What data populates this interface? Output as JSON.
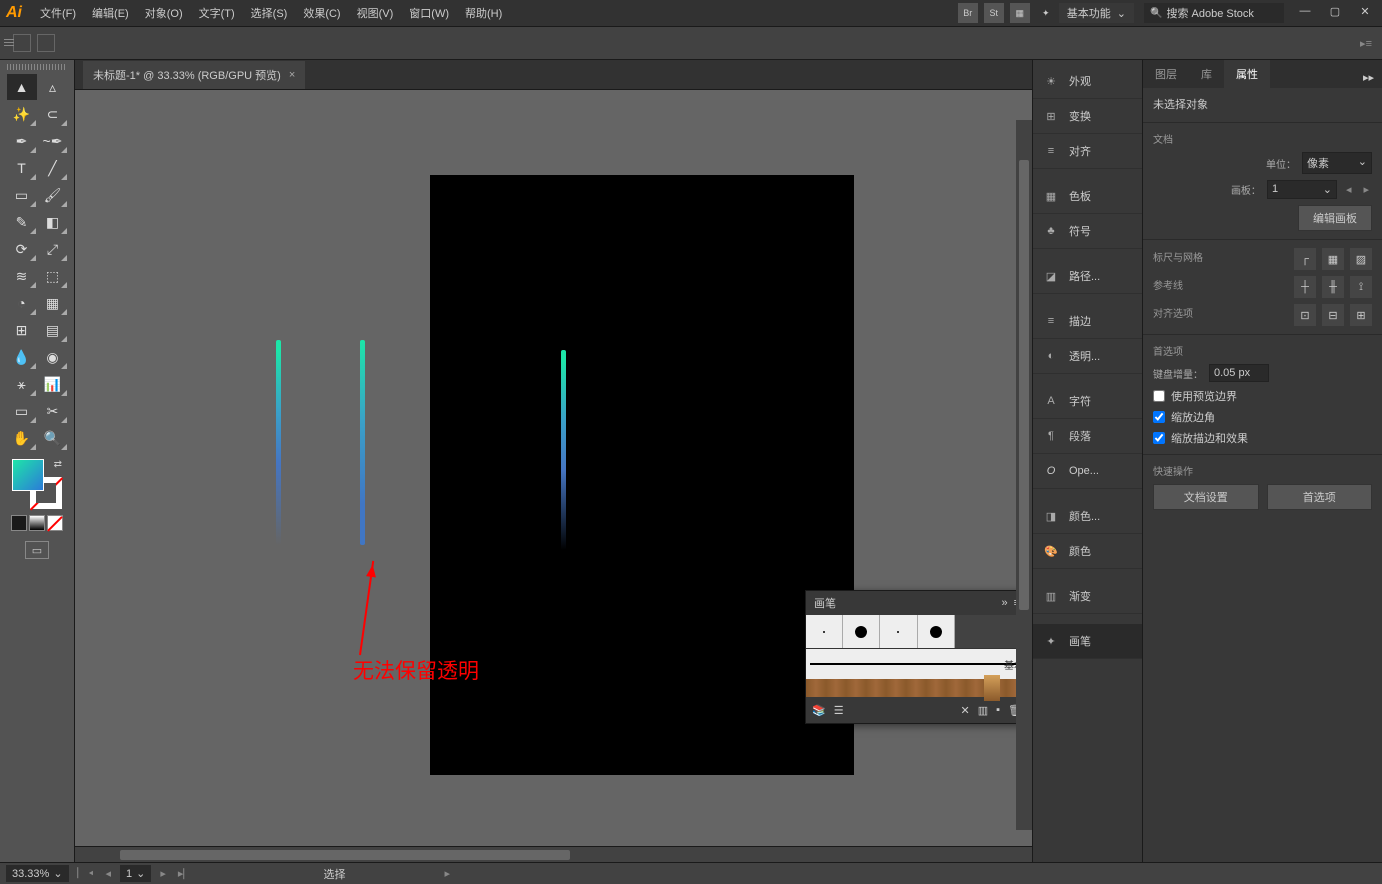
{
  "app": {
    "logo": "Ai"
  },
  "menu": {
    "file": "文件(F)",
    "edit": "编辑(E)",
    "object": "对象(O)",
    "type": "文字(T)",
    "select": "选择(S)",
    "effect": "效果(C)",
    "view": "视图(V)",
    "window": "窗口(W)",
    "help": "帮助(H)"
  },
  "workspace": {
    "label": "基本功能"
  },
  "search": {
    "placeholder": "搜索 Adobe Stock"
  },
  "document": {
    "tab_title": "未标题-1* @ 33.33% (RGB/GPU 预览)",
    "close": "×"
  },
  "annotation": {
    "text": "无法保留透明"
  },
  "brush_panel": {
    "title": "画笔",
    "basic": "基本",
    "expand": "»"
  },
  "dock": {
    "appearance": "外观",
    "transform": "变换",
    "align": "对齐",
    "swatches": "色板",
    "symbols": "符号",
    "pathfinder": "路径...",
    "stroke": "描边",
    "transparency": "透明...",
    "character": "字符",
    "paragraph": "段落",
    "opentype": "Ope...",
    "colorguide": "颜色...",
    "color": "颜色",
    "gradient": "渐变",
    "brushes": "画笔"
  },
  "panel_tabs": {
    "layers": "图层",
    "libraries": "库",
    "properties": "属性"
  },
  "props": {
    "no_sel": "未选择对象",
    "doc_sect": "文档",
    "unit_label": "单位：",
    "unit_value": "像素",
    "artboard_label": "画板：",
    "artboard_value": "1",
    "edit_artboards": "编辑画板",
    "ruler_grid": "标尺与网格",
    "guides": "参考线",
    "align_options": "对齐选项",
    "prefs": "首选项",
    "key_inc_label": "键盘增量：",
    "key_inc_value": "0.05 px",
    "use_preview": "使用预览边界",
    "scale_corners": "缩放边角",
    "scale_strokes": "缩放描边和效果",
    "quick": "快速操作",
    "doc_setup": "文档设置",
    "prefs_btn": "首选项",
    "nav_prev": "◂",
    "nav_next": "▸"
  },
  "status": {
    "zoom": "33.33%",
    "page": "1",
    "mode": "选择",
    "nav_play": "▸"
  }
}
